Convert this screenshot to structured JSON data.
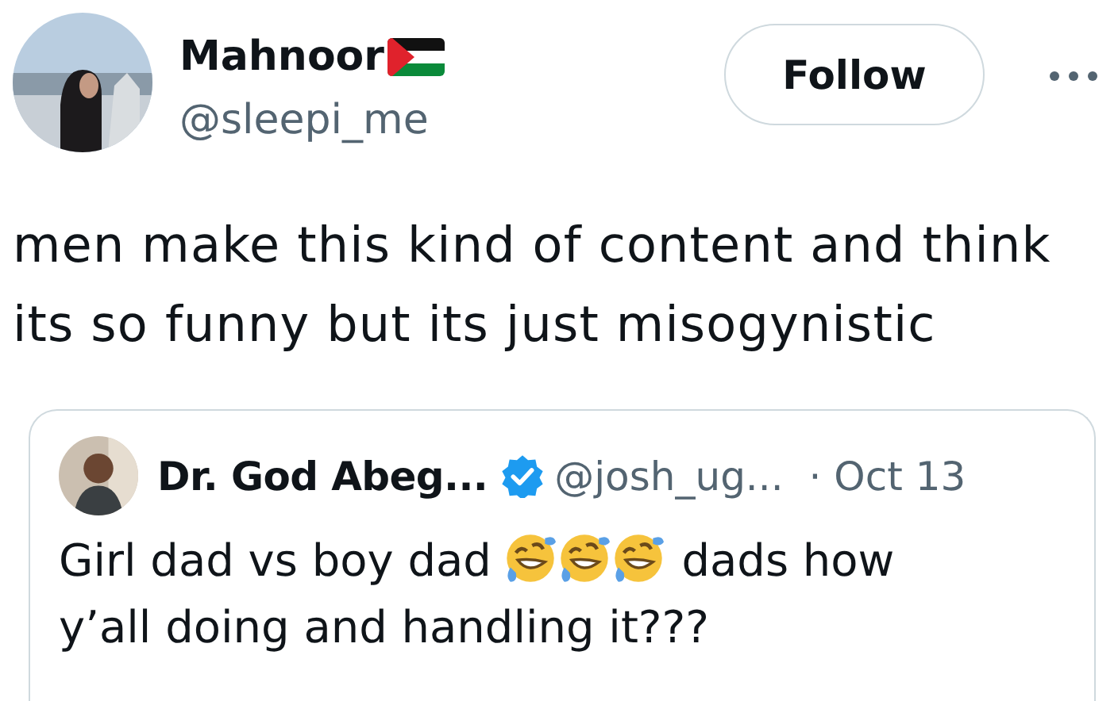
{
  "author": {
    "name": "Mahnoor",
    "handle": "@sleepi_me"
  },
  "follow_button": {
    "label": "Follow"
  },
  "text": "men make this kind of content and think its so funny but its just misogynistic",
  "quote": {
    "name": "Dr. God Abeg...",
    "verified": true,
    "handle": "@josh_ug...",
    "date": "· Oct 13",
    "segments": [
      {
        "kind": "text",
        "text": "Girl dad vs boy dad"
      },
      {
        "kind": "emoji"
      },
      {
        "kind": "emoji"
      },
      {
        "kind": "emoji"
      },
      {
        "kind": "text",
        "text": "dads how"
      },
      {
        "kind": "text",
        "text": "y’all doing and handling it???"
      }
    ]
  }
}
